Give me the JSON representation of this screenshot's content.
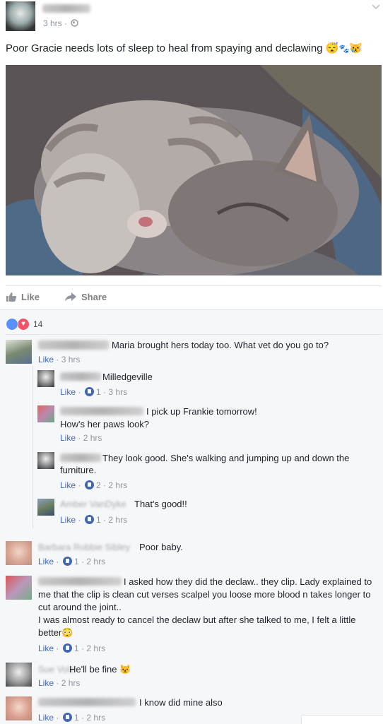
{
  "post": {
    "time": "3 hrs",
    "text": "Poor Gracie needs lots of sleep to heal from spaying and declawing",
    "emoji1": "😴",
    "emoji2": "🐾",
    "emoji3": "😿"
  },
  "actions": {
    "like": "Like",
    "share": "Share"
  },
  "reactions": {
    "count": "14"
  },
  "comments": [
    {
      "text": "Maria brought hers today too. What vet do you go to?",
      "like": "Like",
      "time": "3 hrs"
    },
    {
      "text": "Milledgeville",
      "like": "Like",
      "reacts": "1",
      "time": "3 hrs"
    },
    {
      "text1": "I pick up Frankie tomorrow!",
      "text2": "How's her paws look?",
      "like": "Like",
      "time": "2 hrs"
    },
    {
      "text1": "They look good. She's walking and jumping up and down the",
      "text2": "furniture.",
      "like": "Like",
      "reacts": "2",
      "time": "2 hrs"
    },
    {
      "author": "Amber VanDyke",
      "text": "That's good!!",
      "like": "Like",
      "reacts": "1",
      "time": "2 hrs"
    },
    {
      "author": "Barbara Robbie Sibley",
      "text": "Poor baby.",
      "like": "Like",
      "reacts": "1",
      "time": "2 hrs"
    },
    {
      "line1": "I asked how they did the declaw.. they clip. Lady explained to",
      "line2": "me that the clip is clean cut verses scalpel you loose more blood n takes longer to",
      "line3": "cut around the joint..",
      "line4": "I was almost ready to cancel the declaw but after she talked to me, I felt a little",
      "line5": "better",
      "emoji": "😳",
      "like": "Like",
      "reacts": "1",
      "time": "2 hrs"
    },
    {
      "author": "Sue Volz",
      "text": "He'll be fine",
      "emoji": "😾",
      "like": "Like",
      "time": "2 hrs"
    },
    {
      "text": "I know did mine also",
      "like": "Like",
      "reacts": "1",
      "time": "2 hrs"
    }
  ],
  "separator": "·"
}
